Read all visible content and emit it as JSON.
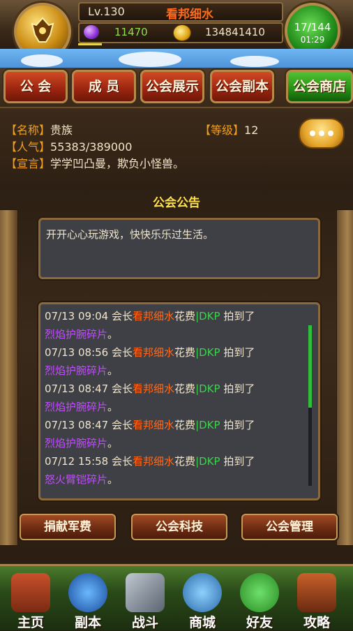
{
  "top": {
    "level": "Lv.130",
    "player_name": "看邦细水",
    "gems": "11470",
    "gold": "134841410",
    "energy": "17/144",
    "timer": "01:29"
  },
  "tabs": [
    "公 会",
    "成 员",
    "公会展示",
    "公会副本",
    "公会商店"
  ],
  "guild": {
    "name_label": "【名称】",
    "name": "贵族",
    "level_label": "【等级】",
    "level": "12",
    "pop_label": "【人气】",
    "popularity": "55383/389000",
    "motto_label": "【宣言】",
    "motto": "学学凹凸曼，欺负小怪兽。"
  },
  "notice": {
    "title": "公会公告",
    "text": "开开心心玩游戏，快快乐乐过生活。"
  },
  "log": [
    {
      "time": "07/13 09:04",
      "role": "会长",
      "name": "看邦细水",
      "act": "花费",
      "dkp": "|DKP",
      "result": "拍到了",
      "item": "烈焰护腕碎片",
      "end": "。"
    },
    {
      "time": "07/13 08:56",
      "role": "会长",
      "name": "看邦细水",
      "act": "花费",
      "dkp": "|DKP",
      "result": "拍到了",
      "item": "烈焰护腕碎片",
      "end": "。"
    },
    {
      "time": "07/13 08:47",
      "role": "会长",
      "name": "看邦细水",
      "act": "花费",
      "dkp": "|DKP",
      "result": "拍到了",
      "item": "烈焰护腕碎片",
      "end": "。"
    },
    {
      "time": "07/13 08:47",
      "role": "会长",
      "name": "看邦细水",
      "act": "花费",
      "dkp": "|DKP",
      "result": "拍到了",
      "item": "烈焰护腕碎片",
      "end": "。"
    },
    {
      "time": "07/12 15:58",
      "role": "会长",
      "name": "看邦细水",
      "act": "花费",
      "dkp": "|DKP",
      "result": "拍到了",
      "item": "怒火臂铠碎片",
      "end": "。"
    }
  ],
  "actions": [
    "捐献军费",
    "公会科技",
    "公会管理"
  ],
  "nav": [
    "主页",
    "副本",
    "战斗",
    "商城",
    "好友",
    "攻略"
  ],
  "colors": {
    "player_name": "#ff6a1a",
    "item": "#c24cff",
    "dkp": "#3bd44a",
    "label": "#f0a020",
    "title": "#ffe14a"
  }
}
